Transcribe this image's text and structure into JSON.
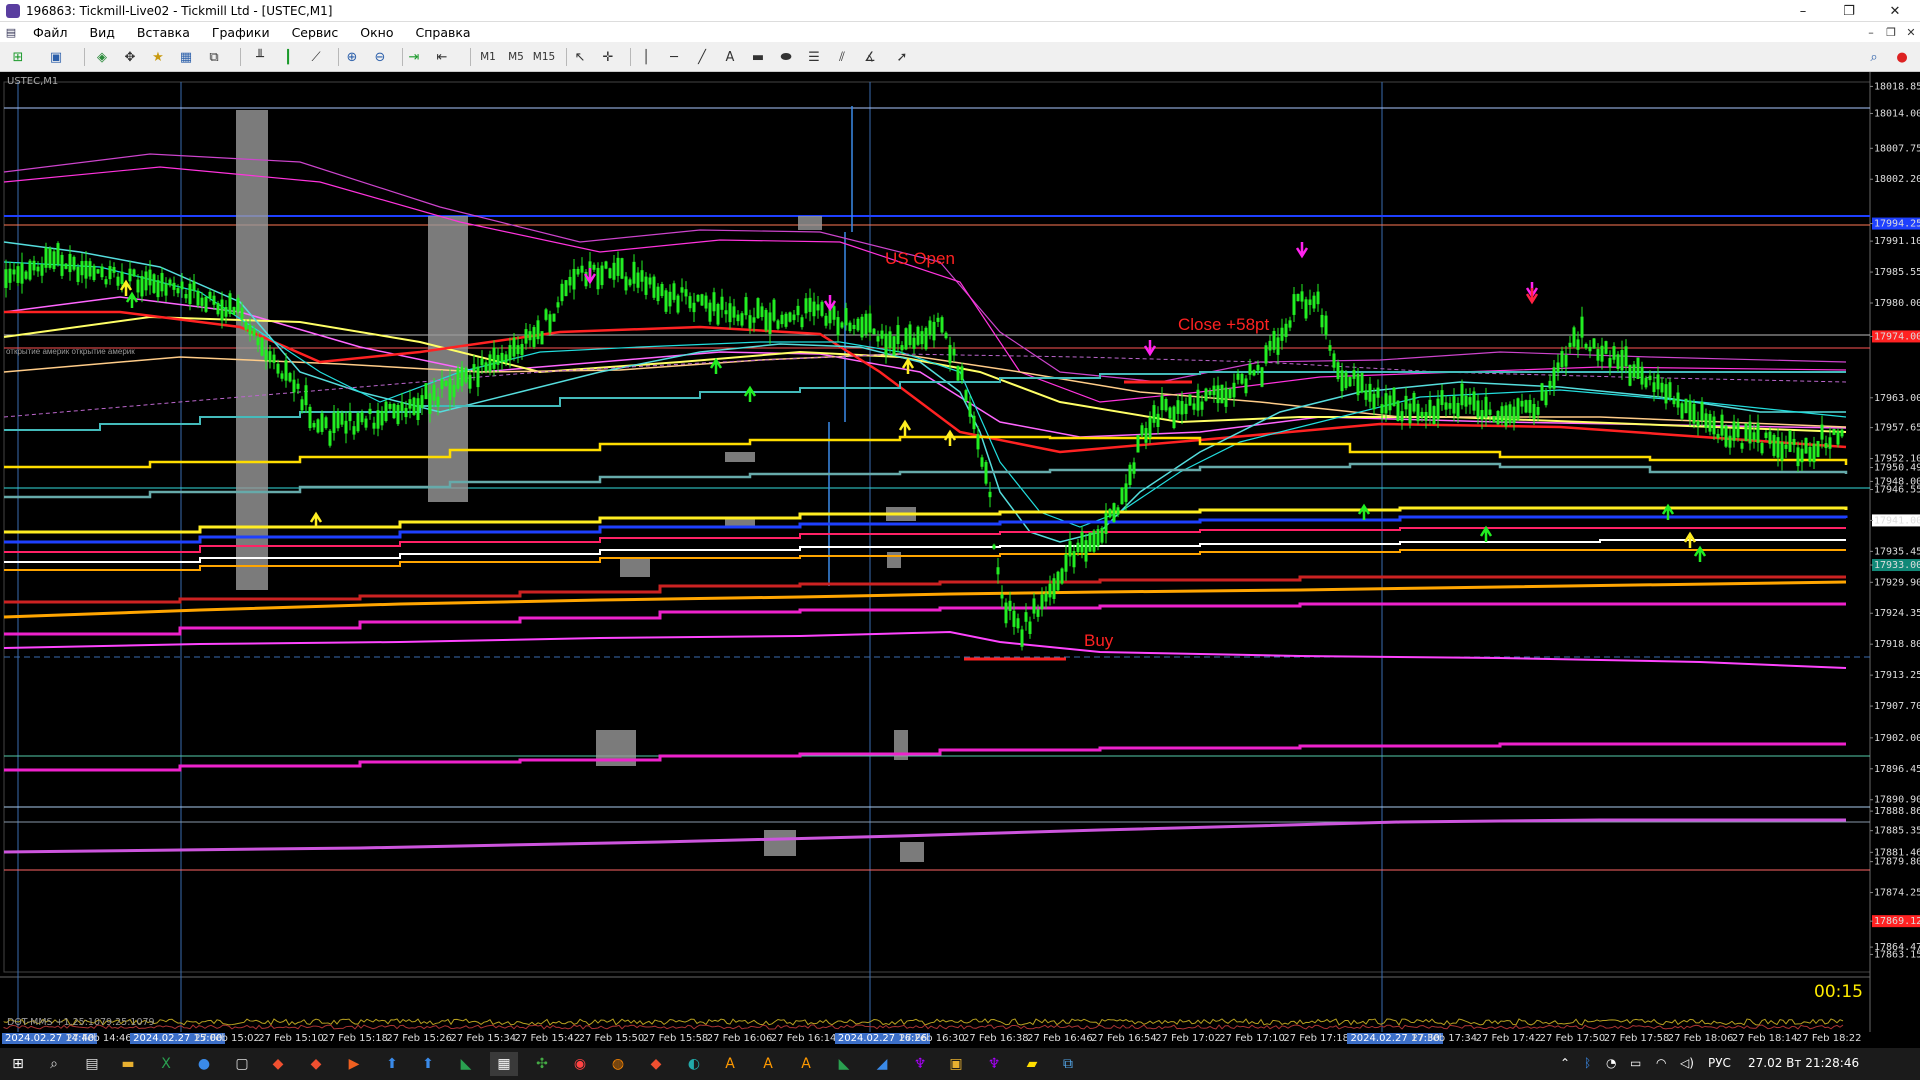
{
  "window": {
    "title": "196863: Tickmill-Live02 - Tickmill Ltd - [USTEC,M1]",
    "minimize": "–",
    "restore": "❐",
    "close": "✕"
  },
  "menu": [
    "Файл",
    "Вид",
    "Вставка",
    "Графики",
    "Сервис",
    "Окно",
    "Справка"
  ],
  "toolbar": {
    "timeframes": [
      "M1",
      "M5",
      "M15"
    ],
    "text_tool": "A"
  },
  "chart": {
    "symbol_label": "USTEC,M1",
    "object_label": "открытие америк",
    "annotations": {
      "us_open": "US Open",
      "close": "Close +58pt",
      "buy": "Buy"
    },
    "timer": "00:15",
    "indicator_title": "DOT-MMS  +1.25:1079.25:1079",
    "price_axis": [
      "18018.85",
      "18014.00",
      "18007.75",
      "18002.20",
      "17994.25",
      "17991.10",
      "17985.55",
      "17980.00",
      "17974.00",
      "17963.00",
      "17957.65",
      "17952.10",
      "17950.49",
      "17948.00",
      "17946.55",
      "17941.00",
      "17935.45",
      "17933.00",
      "17929.90",
      "17924.35",
      "17918.80",
      "17913.25",
      "17907.70",
      "17902.00",
      "17896.45",
      "17890.90",
      "17888.86",
      "17885.35",
      "17881.46",
      "17879.80",
      "17874.25",
      "17869.12",
      "17864.47",
      "17863.15"
    ],
    "price_highlights": {
      "blue_line": "17994.25",
      "red_line_1": "17974.00",
      "red_line_2": "17966.00",
      "current": "17941.00",
      "teal": "17933.00",
      "bottom_red": "17869.12"
    },
    "colors": {
      "background": "#000000",
      "candle": "#22ee22",
      "magenta": "#ff22ee",
      "red": "#ff1a1a",
      "yellow": "#ffee22",
      "orange": "#ffa500",
      "cyan": "#33dddd",
      "blue": "#1e40ff",
      "annotation": "#ff2222",
      "gray_box": "#9a9a9a"
    }
  },
  "time_axis": [
    {
      "label": "2024.02.27 14:40",
      "highlight": true
    },
    {
      "label": "27 Feb 14:46",
      "highlight": false
    },
    {
      "label": "2024.02.27 15:00",
      "highlight": true
    },
    {
      "label": "27 Feb 15:02",
      "highlight": false
    },
    {
      "label": "27 Feb 15:10",
      "highlight": false
    },
    {
      "label": "27 Feb 15:18",
      "highlight": false
    },
    {
      "label": "27 Feb 15:26",
      "highlight": false
    },
    {
      "label": "27 Feb 15:34",
      "highlight": false
    },
    {
      "label": "27 Feb 15:42",
      "highlight": false
    },
    {
      "label": "27 Feb 15:50",
      "highlight": false
    },
    {
      "label": "27 Feb 15:58",
      "highlight": false
    },
    {
      "label": "27 Feb 16:06",
      "highlight": false
    },
    {
      "label": "27 Feb 16:14",
      "highlight": false
    },
    {
      "label": "2024.02.27 16:26",
      "highlight": true
    },
    {
      "label": "27 Feb 16:30",
      "highlight": false
    },
    {
      "label": "27 Feb 16:38",
      "highlight": false
    },
    {
      "label": "27 Feb 16:46",
      "highlight": false
    },
    {
      "label": "27 Feb 16:54",
      "highlight": false
    },
    {
      "label": "27 Feb 17:02",
      "highlight": false
    },
    {
      "label": "27 Feb 17:10",
      "highlight": false
    },
    {
      "label": "27 Feb 17:18",
      "highlight": false
    },
    {
      "label": "2024.02.27 17:30",
      "highlight": true
    },
    {
      "label": "27 Feb 17:34",
      "highlight": false
    },
    {
      "label": "27 Feb 17:42",
      "highlight": false
    },
    {
      "label": "27 Feb 17:50",
      "highlight": false
    },
    {
      "label": "27 Feb 17:58",
      "highlight": false
    },
    {
      "label": "27 Feb 18:06",
      "highlight": false
    },
    {
      "label": "27 Feb 18:14",
      "highlight": false
    },
    {
      "label": "27 Feb 18:22",
      "highlight": false
    }
  ],
  "taskbar": {
    "language": "РУС",
    "datetime": "27.02 Вт 21:28:46"
  }
}
